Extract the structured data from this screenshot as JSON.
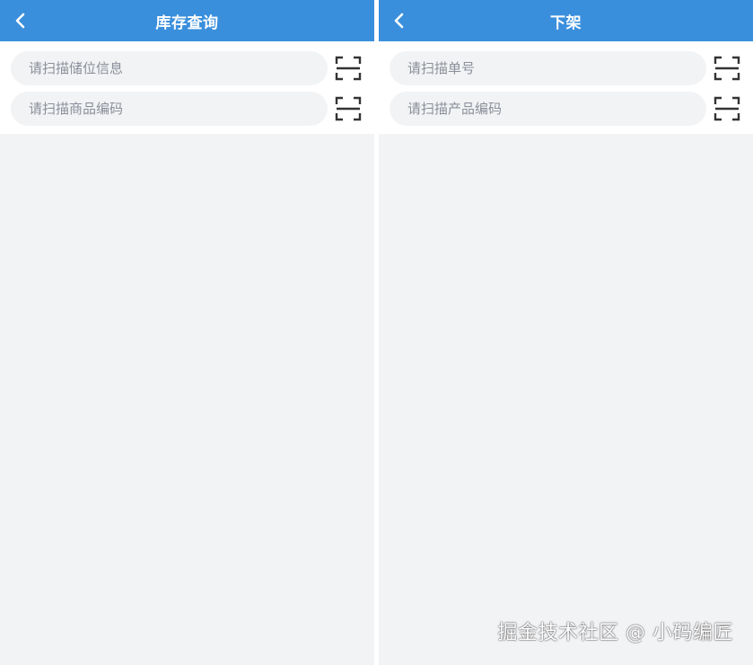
{
  "colors": {
    "navbar_bg": "#3a8fdc",
    "page_bg": "#f2f3f5",
    "input_bg": "#f2f3f5",
    "placeholder": "#8a8f99"
  },
  "screens": [
    {
      "title": "库存查询",
      "back_icon": "chevron-left-icon",
      "fields": [
        {
          "placeholder": "请扫描储位信息",
          "value": "",
          "scan_icon": "scan-icon"
        },
        {
          "placeholder": "请扫描商品编码",
          "value": "",
          "scan_icon": "scan-icon"
        }
      ]
    },
    {
      "title": "下架",
      "back_icon": "chevron-left-icon",
      "fields": [
        {
          "placeholder": "请扫描单号",
          "value": "",
          "scan_icon": "scan-icon"
        },
        {
          "placeholder": "请扫描产品编码",
          "value": "",
          "scan_icon": "scan-icon"
        }
      ]
    }
  ],
  "watermark": "掘金技术社区 @ 小码编匠"
}
